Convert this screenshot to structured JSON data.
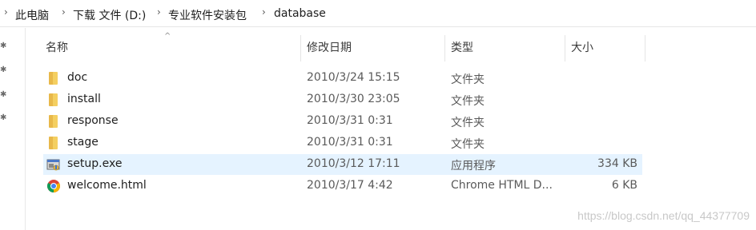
{
  "breadcrumb": [
    {
      "label": "此电脑"
    },
    {
      "label": "下载 文件 (D:)"
    },
    {
      "label": "专业软件安装包"
    },
    {
      "label": "database"
    }
  ],
  "columns": {
    "name": "名称",
    "modified": "修改日期",
    "type": "类型",
    "size": "大小"
  },
  "files": [
    {
      "name": "doc",
      "modified": "2010/3/24 15:15",
      "type": "文件夹",
      "size": "",
      "icon": "folder-icon"
    },
    {
      "name": "install",
      "modified": "2010/3/30 23:05",
      "type": "文件夹",
      "size": "",
      "icon": "folder-icon"
    },
    {
      "name": "response",
      "modified": "2010/3/31 0:31",
      "type": "文件夹",
      "size": "",
      "icon": "folder-icon"
    },
    {
      "name": "stage",
      "modified": "2010/3/31 0:31",
      "type": "文件夹",
      "size": "",
      "icon": "folder-icon"
    },
    {
      "name": "setup.exe",
      "modified": "2010/3/12 17:11",
      "type": "应用程序",
      "size": "334 KB",
      "icon": "installer-icon",
      "selected": true
    },
    {
      "name": "welcome.html",
      "modified": "2010/3/17 4:42",
      "type": "Chrome HTML D...",
      "size": "6 KB",
      "icon": "chrome-icon"
    }
  ],
  "watermark": "https://blog.csdn.net/qq_44377709",
  "colors": {
    "selection": "#e5f3ff",
    "folder": "#f4cf61"
  }
}
